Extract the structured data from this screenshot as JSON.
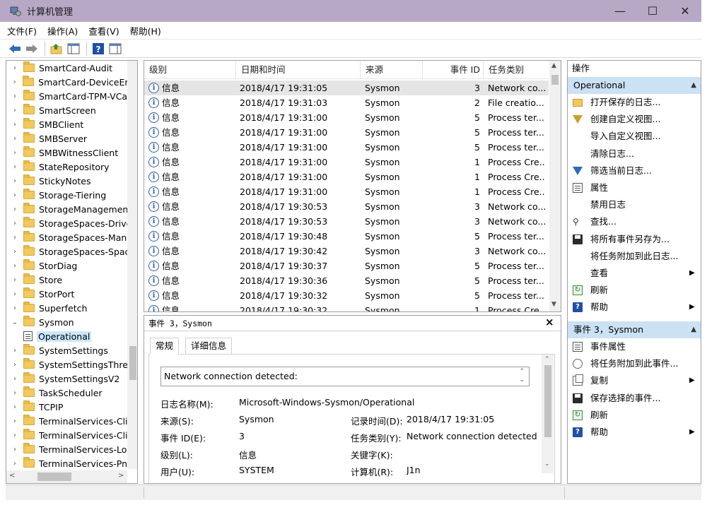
{
  "window": {
    "title": "计算机管理",
    "minimize": "—",
    "maximize": "☐",
    "close": "✕"
  },
  "menu": [
    "文件(F)",
    "操作(A)",
    "查看(V)",
    "帮助(H)"
  ],
  "tree": {
    "items": [
      {
        "label": "SmartCard-Audit",
        "expanded": false
      },
      {
        "label": "SmartCard-DeviceEnum",
        "expanded": false
      },
      {
        "label": "SmartCard-TPM-VCard",
        "expanded": false
      },
      {
        "label": "SmartScreen",
        "expanded": false
      },
      {
        "label": "SMBClient",
        "expanded": false
      },
      {
        "label": "SMBServer",
        "expanded": false
      },
      {
        "label": "SMBWitnessClient",
        "expanded": false
      },
      {
        "label": "StateRepository",
        "expanded": false
      },
      {
        "label": "StickyNotes",
        "expanded": false
      },
      {
        "label": "Storage-Tiering",
        "expanded": false
      },
      {
        "label": "StorageManagement",
        "expanded": false
      },
      {
        "label": "StorageSpaces-Driver",
        "expanded": false
      },
      {
        "label": "StorageSpaces-Manag",
        "expanded": false
      },
      {
        "label": "StorageSpaces-Space",
        "expanded": false
      },
      {
        "label": "StorDiag",
        "expanded": false
      },
      {
        "label": "Store",
        "expanded": false
      },
      {
        "label": "StorPort",
        "expanded": false
      },
      {
        "label": "Superfetch",
        "expanded": false
      },
      {
        "label": "Sysmon",
        "expanded": true
      },
      {
        "label": "Operational",
        "child": true,
        "selected": true
      },
      {
        "label": "SystemSettings",
        "expanded": false
      },
      {
        "label": "SystemSettingsThresh",
        "expanded": false
      },
      {
        "label": "SystemSettingsV2",
        "expanded": false
      },
      {
        "label": "TaskScheduler",
        "expanded": false
      },
      {
        "label": "TCPIP",
        "expanded": false
      },
      {
        "label": "TerminalServices-Clien",
        "expanded": false
      },
      {
        "label": "TerminalServices-Clien",
        "expanded": false
      },
      {
        "label": "TerminalServices-Loca",
        "expanded": false
      },
      {
        "label": "TerminalServices-PnPD",
        "expanded": false
      }
    ]
  },
  "events": {
    "columns": [
      "级别",
      "日期和时间",
      "来源",
      "事件 ID",
      "任务类别"
    ],
    "rows": [
      {
        "level": "信息",
        "datetime": "2018/4/17 19:31:05",
        "source": "Sysmon",
        "id": "3",
        "task": "Network co..."
      },
      {
        "level": "信息",
        "datetime": "2018/4/17 19:31:03",
        "source": "Sysmon",
        "id": "2",
        "task": "File creatio..."
      },
      {
        "level": "信息",
        "datetime": "2018/4/17 19:31:00",
        "source": "Sysmon",
        "id": "5",
        "task": "Process ter..."
      },
      {
        "level": "信息",
        "datetime": "2018/4/17 19:31:00",
        "source": "Sysmon",
        "id": "5",
        "task": "Process ter..."
      },
      {
        "level": "信息",
        "datetime": "2018/4/17 19:31:00",
        "source": "Sysmon",
        "id": "5",
        "task": "Process ter..."
      },
      {
        "level": "信息",
        "datetime": "2018/4/17 19:31:00",
        "source": "Sysmon",
        "id": "1",
        "task": "Process Cre..."
      },
      {
        "level": "信息",
        "datetime": "2018/4/17 19:31:00",
        "source": "Sysmon",
        "id": "1",
        "task": "Process Cre..."
      },
      {
        "level": "信息",
        "datetime": "2018/4/17 19:31:00",
        "source": "Sysmon",
        "id": "1",
        "task": "Process Cre..."
      },
      {
        "level": "信息",
        "datetime": "2018/4/17 19:30:53",
        "source": "Sysmon",
        "id": "3",
        "task": "Network co..."
      },
      {
        "level": "信息",
        "datetime": "2018/4/17 19:30:53",
        "source": "Sysmon",
        "id": "3",
        "task": "Network co..."
      },
      {
        "level": "信息",
        "datetime": "2018/4/17 19:30:48",
        "source": "Sysmon",
        "id": "5",
        "task": "Process ter..."
      },
      {
        "level": "信息",
        "datetime": "2018/4/17 19:30:42",
        "source": "Sysmon",
        "id": "3",
        "task": "Network co..."
      },
      {
        "level": "信息",
        "datetime": "2018/4/17 19:30:37",
        "source": "Sysmon",
        "id": "5",
        "task": "Process ter..."
      },
      {
        "level": "信息",
        "datetime": "2018/4/17 19:30:36",
        "source": "Sysmon",
        "id": "5",
        "task": "Process ter..."
      },
      {
        "level": "信息",
        "datetime": "2018/4/17 19:30:32",
        "source": "Sysmon",
        "id": "5",
        "task": "Process ter..."
      },
      {
        "level": "信息",
        "datetime": "2018/4/17 19:30:32",
        "source": "Sysmon",
        "id": "1",
        "task": "Process Cre..."
      }
    ]
  },
  "detail": {
    "title": "事件 3，Sysmon",
    "close": "×",
    "tabs": [
      "常规",
      "详细信息"
    ],
    "description": "Network connection detected:",
    "fields": {
      "log_name_label": "日志名称(M):",
      "log_name_value": "Microsoft-Windows-Sysmon/Operational",
      "source_label": "来源(S):",
      "source_value": "Sysmon",
      "logged_label": "记录时间(D):",
      "logged_value": "2018/4/17 19:31:05",
      "event_id_label": "事件 ID(E):",
      "event_id_value": "3",
      "task_label": "任务类别(Y):",
      "task_value": "Network connection detected (r",
      "level_label": "级别(L):",
      "level_value": "信息",
      "keywords_label": "关键字(K):",
      "keywords_value": "",
      "user_label": "用户(U):",
      "user_value": "SYSTEM",
      "computer_label": "计算机(R):",
      "computer_value": "J1n"
    }
  },
  "actions": {
    "header": "操作",
    "section1": "Operational",
    "items1": [
      {
        "label": "打开保存的日志...",
        "icon": "folder-open-icon",
        "submenu": false
      },
      {
        "label": "创建自定义视图...",
        "icon": "filter-create-icon",
        "submenu": false
      },
      {
        "label": "导入自定义视图...",
        "icon": "",
        "submenu": false
      },
      {
        "label": "清除日志...",
        "icon": "",
        "submenu": false
      },
      {
        "label": "筛选当前日志...",
        "icon": "filter-icon",
        "submenu": false
      },
      {
        "label": "属性",
        "icon": "properties-icon",
        "submenu": false
      },
      {
        "label": "禁用日志",
        "icon": "",
        "submenu": false
      },
      {
        "label": "查找...",
        "icon": "find-icon",
        "submenu": false
      },
      {
        "label": "将所有事件另存为...",
        "icon": "save-icon",
        "submenu": false
      },
      {
        "label": "将任务附加到此日志...",
        "icon": "",
        "submenu": false
      },
      {
        "label": "查看",
        "icon": "",
        "submenu": true
      },
      {
        "label": "刷新",
        "icon": "refresh-icon",
        "submenu": false
      },
      {
        "label": "帮助",
        "icon": "help-icon",
        "submenu": true
      }
    ],
    "section2": "事件 3，Sysmon",
    "items2": [
      {
        "label": "事件属性",
        "icon": "properties-icon",
        "submenu": false
      },
      {
        "label": "将任务附加到此事件...",
        "icon": "task-icon",
        "submenu": false
      },
      {
        "label": "复制",
        "icon": "copy-icon",
        "submenu": true
      },
      {
        "label": "保存选择的事件...",
        "icon": "save-icon",
        "submenu": false
      },
      {
        "label": "刷新",
        "icon": "refresh-icon",
        "submenu": false
      },
      {
        "label": "帮助",
        "icon": "help-icon",
        "submenu": true
      }
    ]
  },
  "colors": {
    "titlebar": "#b7a8c6",
    "section_header": "#cbe1f4",
    "selected_row": "#e5e5e5",
    "info_icon": "#2f5ea8"
  }
}
